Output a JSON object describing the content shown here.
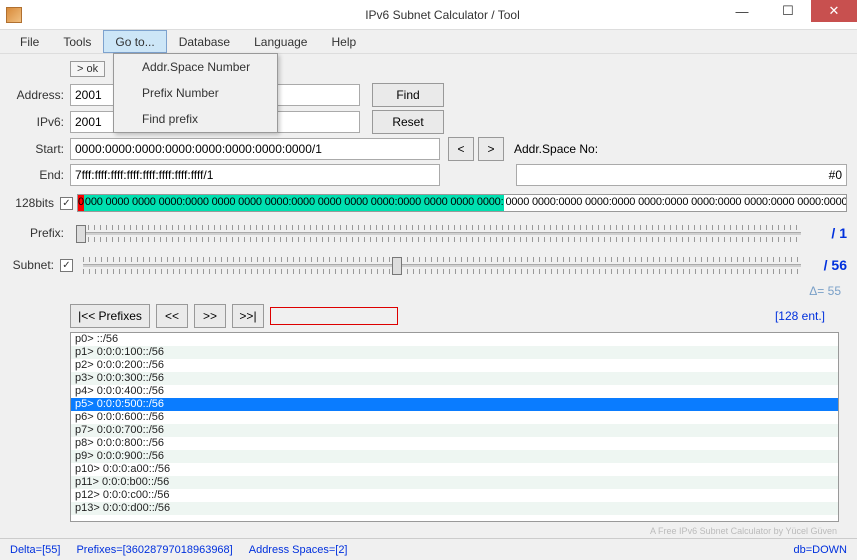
{
  "window": {
    "title": "IPv6 Subnet Calculator / Tool"
  },
  "menu": {
    "file": "File",
    "tools": "Tools",
    "goto": "Go to...",
    "database": "Database",
    "language": "Language",
    "help": "Help"
  },
  "dropdown": {
    "addrspace": "Addr.Space Number",
    "prefixnum": "Prefix Number",
    "findprefix": "Find prefix"
  },
  "ok_badge": "> ok",
  "labels": {
    "address": "Address:",
    "ipv6": "IPv6:",
    "start": "Start:",
    "end": "End:",
    "bits128": "128bits",
    "prefix": "Prefix:",
    "subnet": "Subnet:",
    "addrspaceno": "Addr.Space No:"
  },
  "inputs": {
    "address": "2001",
    "ipv6": "2001",
    "start": "0000:0000:0000:0000:0000:0000:0000:0000/1",
    "end": "7fff:ffff:ffff:ffff:ffff:ffff:ffff:ffff/1",
    "addrspace_display": "#0"
  },
  "buttons": {
    "find": "Find",
    "reset": "Reset",
    "prev": "<",
    "next": ">",
    "pfx_first": "|<< Prefixes",
    "pfx_back": "<<",
    "pfx_fwd": ">>",
    "pfx_last": ">>|"
  },
  "bits": {
    "red": "0",
    "green": "000 0000 0000 0000:0000 0000 0000 0000:0000 0000 0000 0000:0000 0000 0000 0000:",
    "white": "0000 0000:0000 0000:0000 0000:0000 0000:0000 0000:0000 0000:0000 0000:0000 0000:0000 0000 0000 0000"
  },
  "sliders": {
    "prefix_value": "/ 1",
    "subnet_value": "/ 56",
    "delta": "Δ= 55"
  },
  "entries_label": "[128 ent.]",
  "list": [
    "p0> ::/56",
    "p1> 0:0:0:100::/56",
    "p2> 0:0:0:200::/56",
    "p3> 0:0:0:300::/56",
    "p4> 0:0:0:400::/56",
    "p5> 0:0:0:500::/56",
    "p6> 0:0:0:600::/56",
    "p7> 0:0:0:700::/56",
    "p8> 0:0:0:800::/56",
    "p9> 0:0:0:900::/56",
    "p10> 0:0:0:a00::/56",
    "p11> 0:0:0:b00::/56",
    "p12> 0:0:0:c00::/56",
    "p13> 0:0:0:d00::/56"
  ],
  "list_selected_index": 5,
  "credit": "A Free IPv6 Subnet Calculator by Yücel Güven",
  "status": {
    "delta": "Delta=[55]",
    "prefixes": "Prefixes=[36028797018963968]",
    "addrspaces": "Address Spaces=[2]",
    "db": "db=DOWN"
  }
}
